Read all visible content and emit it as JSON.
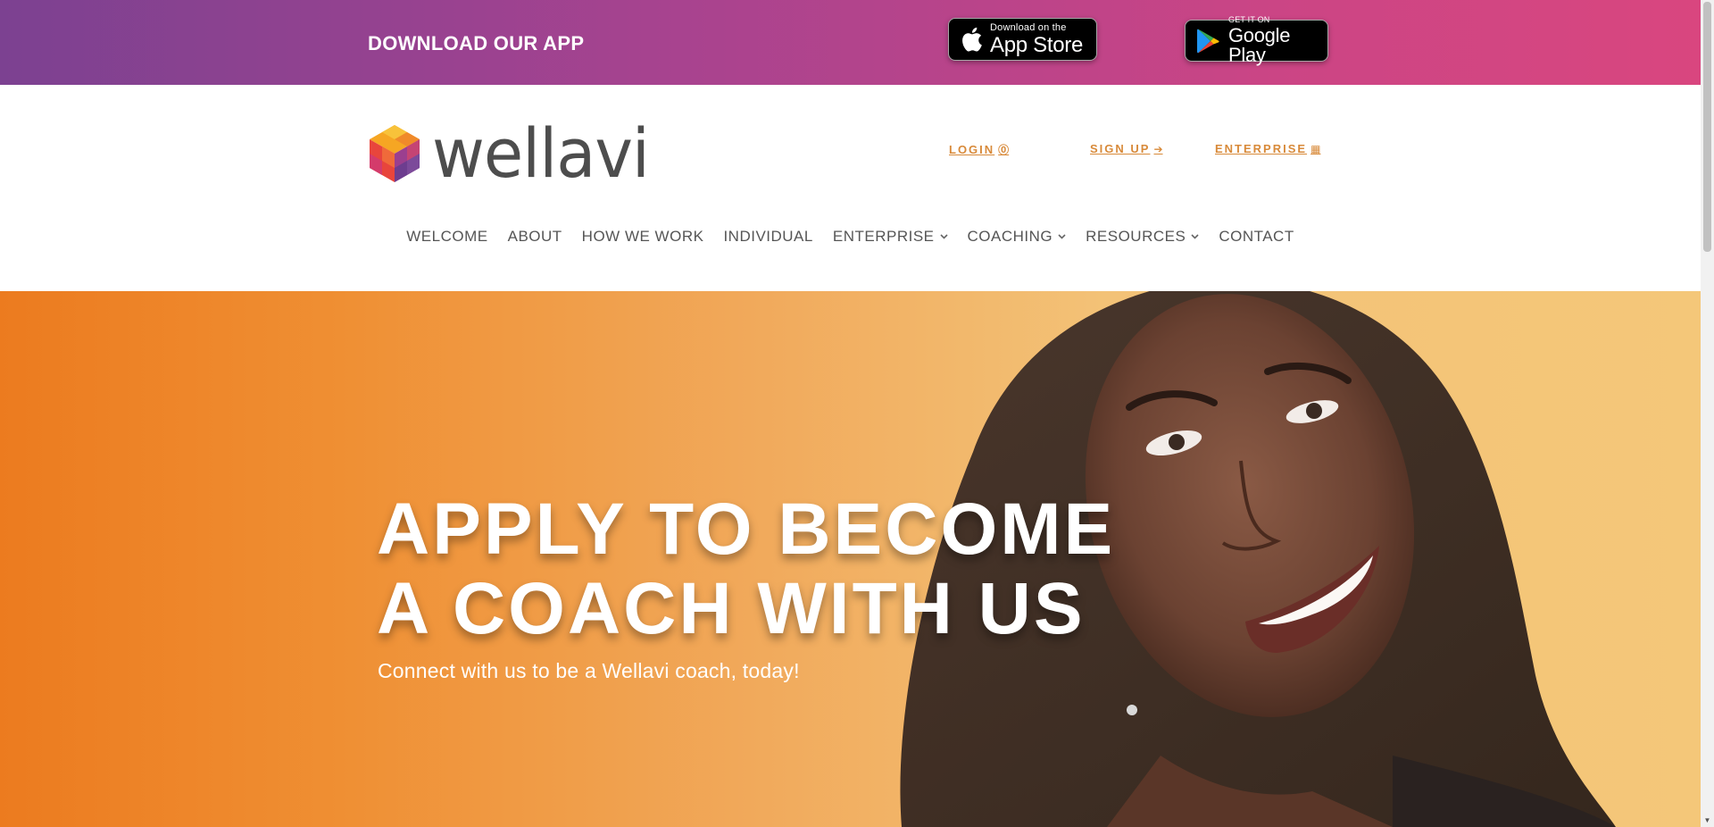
{
  "banner": {
    "title": "DOWNLOAD OUR APP",
    "app_store": {
      "small": "Download on the",
      "big": "App Store",
      "icon": "apple-icon"
    },
    "google_play": {
      "small": "GET IT ON",
      "big": "Google Play",
      "icon": "google-play-icon"
    }
  },
  "header": {
    "logo_text": "wellavi",
    "utility_links": [
      {
        "label": "LOGIN",
        "icon": "user-circle-icon",
        "glyph": "⓪"
      },
      {
        "label": "SIGN UP",
        "icon": "sign-in-icon",
        "glyph": "➔"
      },
      {
        "label": "ENTERPRISE",
        "icon": "building-icon",
        "glyph": "▦"
      }
    ],
    "nav": [
      {
        "label": "WELCOME",
        "dropdown": false
      },
      {
        "label": "ABOUT",
        "dropdown": false
      },
      {
        "label": "HOW WE WORK",
        "dropdown": false
      },
      {
        "label": "INDIVIDUAL",
        "dropdown": false
      },
      {
        "label": "ENTERPRISE",
        "dropdown": true
      },
      {
        "label": "COACHING",
        "dropdown": true
      },
      {
        "label": "RESOURCES",
        "dropdown": true
      },
      {
        "label": "CONTACT",
        "dropdown": false
      }
    ],
    "chevron": "⌄"
  },
  "hero": {
    "title_line1": "APPLY TO BECOME",
    "title_line2": "A COACH WITH US",
    "subtitle": "Connect with us to be a Wellavi coach, today!"
  },
  "colors": {
    "banner_start": "#7c4191",
    "banner_end": "#d9467f",
    "link_accent": "#d88a3a",
    "hero_orange": "#ec7b1f",
    "hero_yellow": "#f4c779"
  }
}
